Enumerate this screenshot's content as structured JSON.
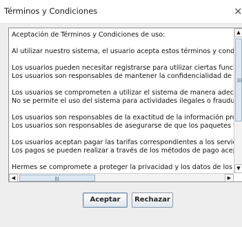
{
  "window": {
    "title": "Términos y Condiciones",
    "close_glyph": "×"
  },
  "terms_text": {
    "lines": [
      "Aceptación de Términos y Condiciones de uso:",
      "",
      "Al utilizar nuestro sistema, el usuario acepta estos términos y condiciones",
      "",
      "Los usuarios pueden necesitar registrarse para utilizar ciertas funciones d",
      "Los usuarios son responsables de mantener la confidencialidad de sus cr",
      "",
      "Los usuarios se comprometen a utilizar el sistema de manera adecuada y",
      "No se permite el uso del sistema para actividades ilegales o fraudulentas.",
      "",
      "Los usuarios son responsables de la exactitud de la información proporcio",
      "Los usuarios son responsables de asegurarse de que los paquetes y envi",
      "",
      "Los usuarios aceptan pagar las tarifas correspondientes a los servicios ut",
      "Los pagos se pueden realizar a través de los métodos de pago aceptados",
      "",
      "Hermes se compromete a proteger la privacidad y los datos de los usuari"
    ]
  },
  "scrollbars": {
    "up_glyph": "▲",
    "down_glyph": "▼",
    "left_glyph": "◀",
    "right_glyph": "▶"
  },
  "buttons": {
    "accept_label": "Aceptar",
    "reject_label": "Rechazar"
  }
}
